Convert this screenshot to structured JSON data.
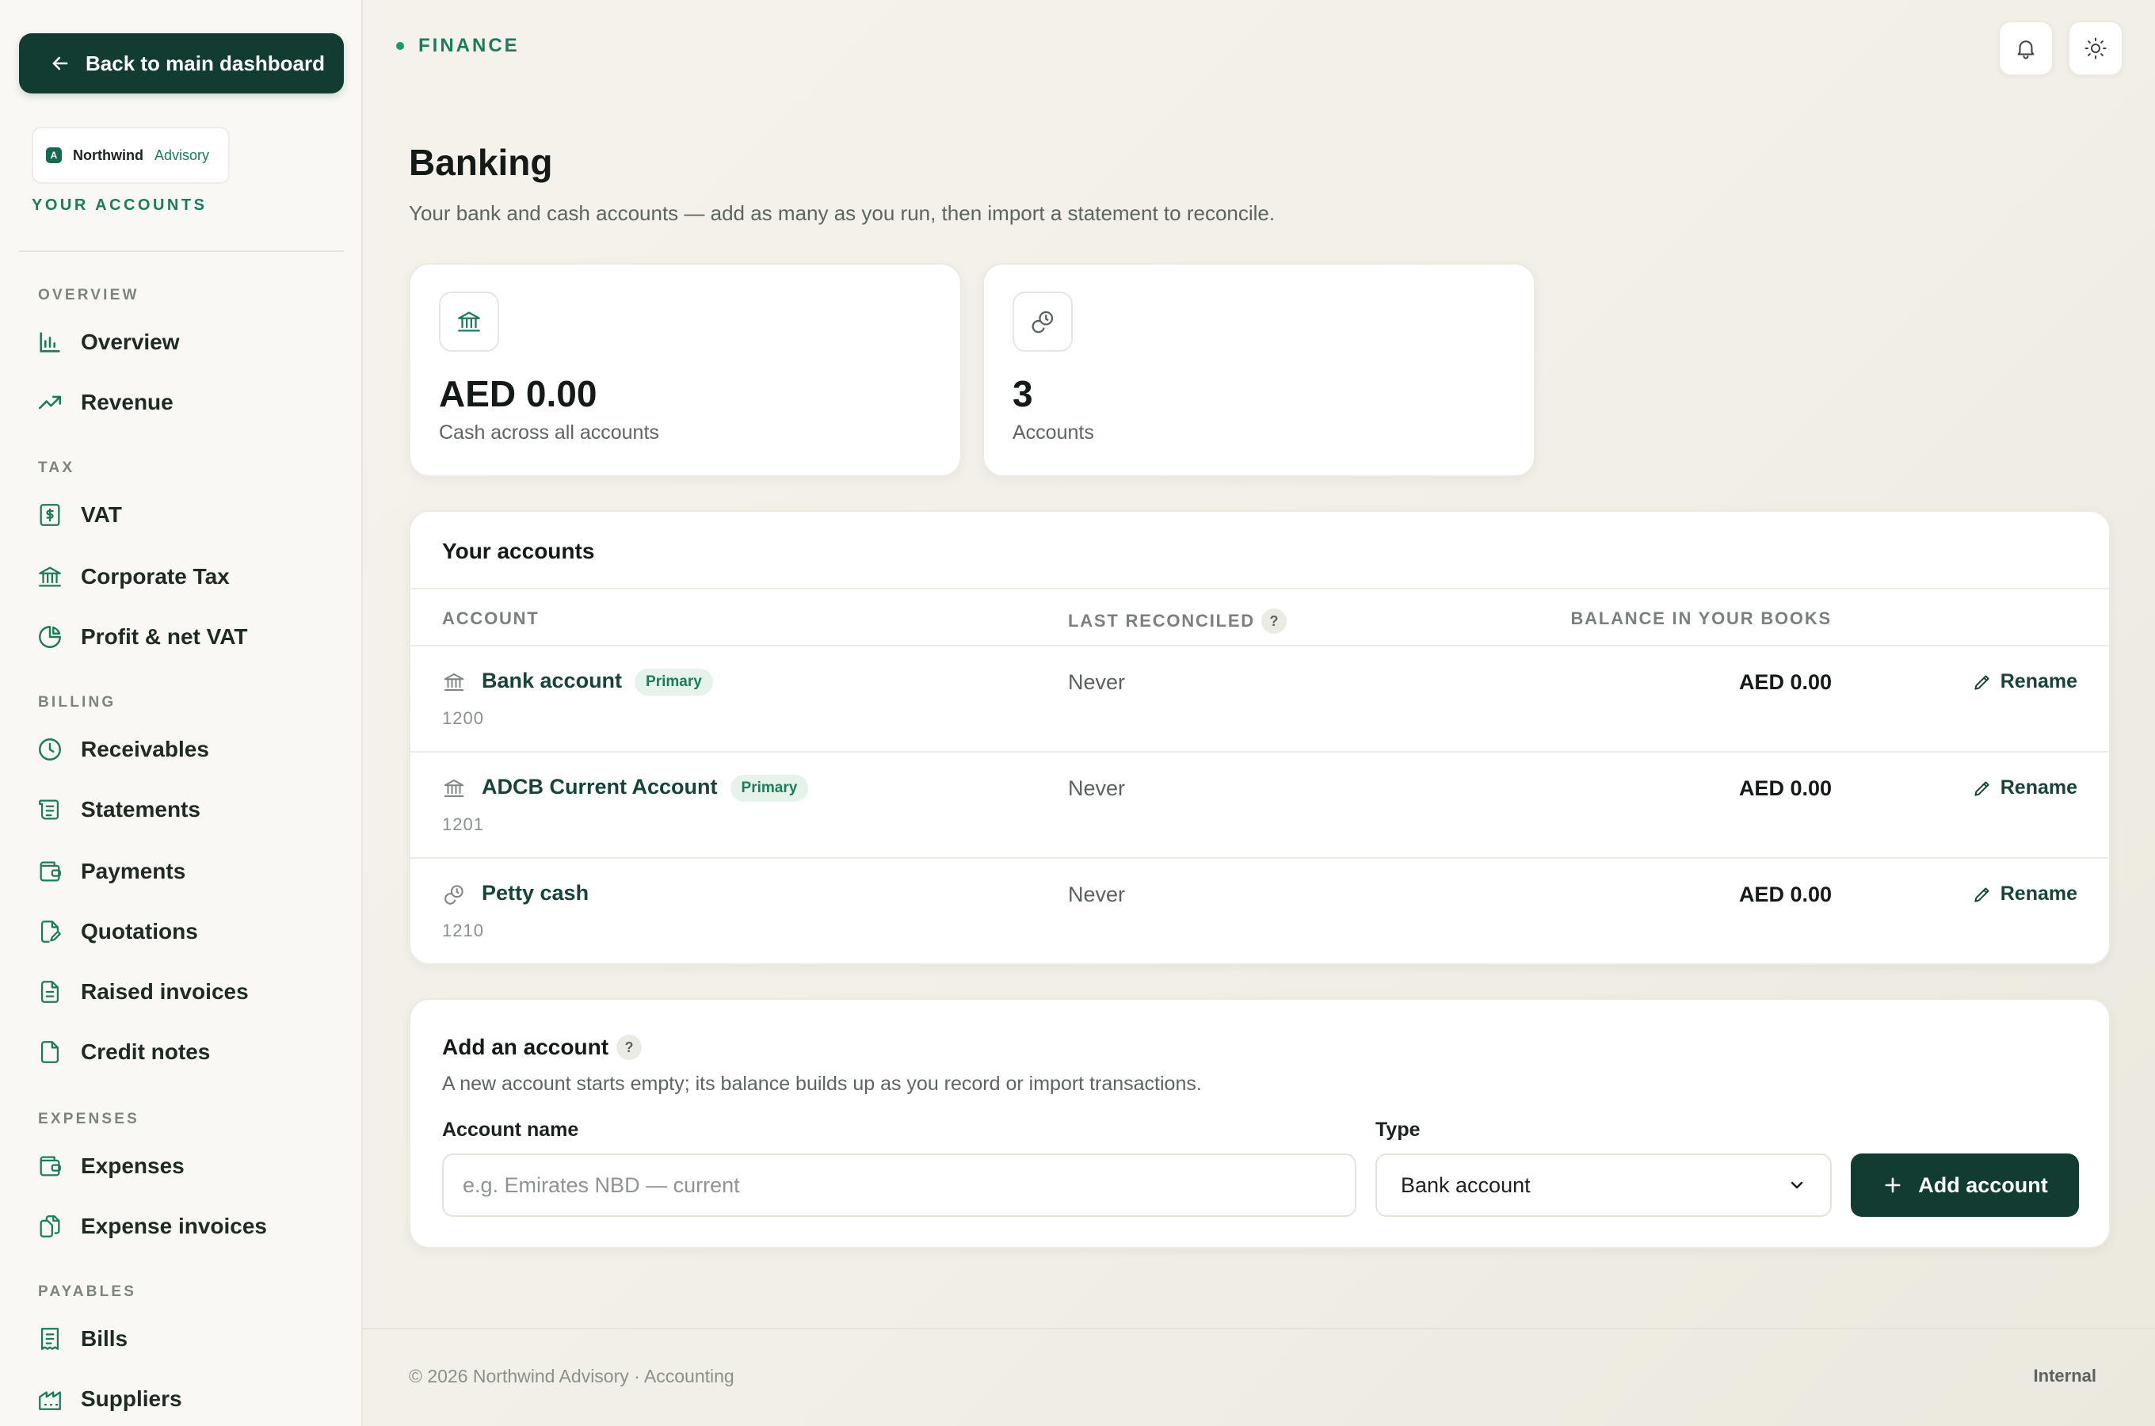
{
  "sidebar": {
    "back_label": "Back to main dashboard",
    "brand": {
      "mark": "A",
      "name": "Northwind",
      "sub": "Advisory"
    },
    "section_label": "YOUR ACCOUNTS",
    "groups": [
      {
        "title": "OVERVIEW",
        "items": [
          {
            "label": "Overview",
            "icon": "bar-chart-icon"
          },
          {
            "label": "Revenue",
            "icon": "trend-up-icon"
          }
        ]
      },
      {
        "title": "TAX",
        "items": [
          {
            "label": "VAT",
            "icon": "dollar-doc-icon"
          },
          {
            "label": "Corporate Tax",
            "icon": "bank-icon"
          },
          {
            "label": "Profit & net VAT",
            "icon": "pie-chart-icon"
          }
        ]
      },
      {
        "title": "BILLING",
        "items": [
          {
            "label": "Receivables",
            "icon": "clock-icon"
          },
          {
            "label": "Statements",
            "icon": "scroll-icon"
          },
          {
            "label": "Payments",
            "icon": "wallet-icon"
          },
          {
            "label": "Quotations",
            "icon": "file-edit-icon"
          },
          {
            "label": "Raised invoices",
            "icon": "file-text-icon"
          },
          {
            "label": "Credit notes",
            "icon": "file-icon"
          }
        ]
      },
      {
        "title": "EXPENSES",
        "items": [
          {
            "label": "Expenses",
            "icon": "wallet-icon"
          },
          {
            "label": "Expense invoices",
            "icon": "files-icon"
          }
        ]
      },
      {
        "title": "PAYABLES",
        "items": [
          {
            "label": "Bills",
            "icon": "receipt-icon"
          },
          {
            "label": "Suppliers",
            "icon": "supplier-icon"
          }
        ]
      }
    ]
  },
  "topbar": {
    "crumb": "FINANCE",
    "icons": [
      "bell-icon",
      "sun-icon"
    ]
  },
  "header": {
    "title": "Banking",
    "subtitle": "Your bank and cash accounts — add as many as you run, then import a statement to reconcile."
  },
  "stats": [
    {
      "value": "AED 0.00",
      "label": "Cash across all accounts",
      "icon": "bank-icon"
    },
    {
      "value": "3",
      "label": "Accounts",
      "icon": "coins-icon"
    }
  ],
  "accounts": {
    "title": "Your accounts",
    "columns": {
      "account": "ACCOUNT",
      "last_reconciled": "LAST RECONCILED",
      "balance": "BALANCE IN YOUR BOOKS"
    },
    "help": "?",
    "rows": [
      {
        "name": "Bank account",
        "badge": "Primary",
        "code": "1200",
        "reconciled": "Never",
        "balance": "AED 0.00",
        "action": "Rename",
        "icon": "bank-icon"
      },
      {
        "name": "ADCB Current Account",
        "badge": "Primary",
        "code": "1201",
        "reconciled": "Never",
        "balance": "AED 0.00",
        "action": "Rename",
        "icon": "bank-icon"
      },
      {
        "name": "Petty cash",
        "badge": "",
        "code": "1210",
        "reconciled": "Never",
        "balance": "AED 0.00",
        "action": "Rename",
        "icon": "coins-icon"
      }
    ]
  },
  "add_form": {
    "title": "Add an account",
    "help": "?",
    "subtitle": "A new account starts empty; its balance builds up as you record or import transactions.",
    "name_label": "Account name",
    "name_placeholder": "e.g. Emirates NBD — current",
    "name_value": "",
    "type_label": "Type",
    "type_value": "Bank account",
    "submit_label": "Add account"
  },
  "footer": {
    "text": "© 2026 Northwind Advisory · Accounting",
    "badge": "Internal"
  },
  "colors": {
    "accent": "#123c31",
    "brand_green": "#1d7a5b",
    "badge_bg": "#e6f3ea"
  }
}
